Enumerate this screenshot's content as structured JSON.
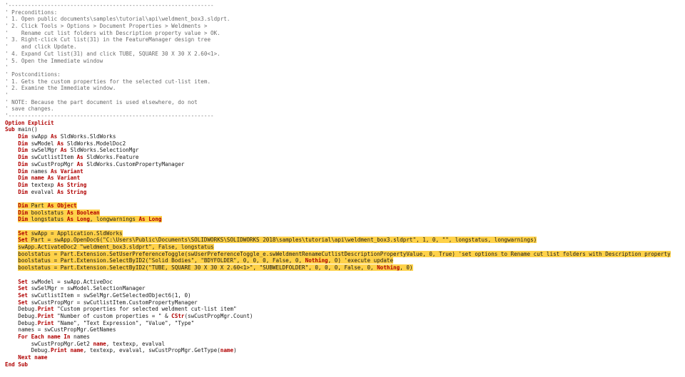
{
  "colors": {
    "keyword": "#b00000",
    "comment": "#6b6b6b",
    "text": "#1a1a1a",
    "highlight": "#ffd24a",
    "background": "#ffffff"
  },
  "lines": [
    {
      "hl": false,
      "parts": [
        {
          "t": "'---------------------------------------------------------------",
          "c": "c"
        }
      ]
    },
    {
      "hl": false,
      "parts": [
        {
          "t": "' Preconditions:",
          "c": "c"
        }
      ]
    },
    {
      "hl": false,
      "parts": [
        {
          "t": "' 1. Open public documents\\samples\\tutorial\\api\\weldment_box3.sldprt.",
          "c": "c"
        }
      ]
    },
    {
      "hl": false,
      "parts": [
        {
          "t": "' 2. Click Tools > Options > Document Properties > Weldments >",
          "c": "c"
        }
      ]
    },
    {
      "hl": false,
      "parts": [
        {
          "t": "'    Rename cut list folders with Description property value > OK.",
          "c": "c"
        }
      ]
    },
    {
      "hl": false,
      "parts": [
        {
          "t": "' 3. Right-click Cut list(31) in the FeatureManager design tree",
          "c": "c"
        }
      ]
    },
    {
      "hl": false,
      "parts": [
        {
          "t": "'    and click Update.",
          "c": "c"
        }
      ]
    },
    {
      "hl": false,
      "parts": [
        {
          "t": "' 4. Expand Cut list(31) and click TUBE, SQUARE 30 X 30 X 2.60<1>.",
          "c": "c"
        }
      ]
    },
    {
      "hl": false,
      "parts": [
        {
          "t": "' 5. Open the Immediate window",
          "c": "c"
        }
      ]
    },
    {
      "hl": false,
      "parts": [
        {
          "t": "'",
          "c": "c"
        }
      ]
    },
    {
      "hl": false,
      "parts": [
        {
          "t": "' Postconditions:",
          "c": "c"
        }
      ]
    },
    {
      "hl": false,
      "parts": [
        {
          "t": "' 1. Gets the custom properties for the selected cut-list item.",
          "c": "c"
        }
      ]
    },
    {
      "hl": false,
      "parts": [
        {
          "t": "' 2. Examine the Immediate window.",
          "c": "c"
        }
      ]
    },
    {
      "hl": false,
      "parts": [
        {
          "t": "'",
          "c": "c"
        }
      ]
    },
    {
      "hl": false,
      "parts": [
        {
          "t": "' NOTE: Because the part document is used elsewhere, do not",
          "c": "c"
        }
      ]
    },
    {
      "hl": false,
      "parts": [
        {
          "t": "' save changes.",
          "c": "c"
        }
      ]
    },
    {
      "hl": false,
      "parts": [
        {
          "t": "'---------------------------------------------------------------",
          "c": "c"
        }
      ]
    },
    {
      "hl": false,
      "parts": [
        {
          "t": "Option Explicit",
          "c": "k"
        }
      ]
    },
    {
      "hl": false,
      "parts": [
        {
          "t": "Sub ",
          "c": "k"
        },
        {
          "t": "main()",
          "c": "t"
        }
      ]
    },
    {
      "hl": false,
      "parts": [
        {
          "t": "    Dim ",
          "c": "k"
        },
        {
          "t": "swApp ",
          "c": "t"
        },
        {
          "t": "As ",
          "c": "k"
        },
        {
          "t": "SldWorks.SldWorks",
          "c": "t"
        }
      ]
    },
    {
      "hl": false,
      "parts": [
        {
          "t": "    Dim ",
          "c": "k"
        },
        {
          "t": "swModel ",
          "c": "t"
        },
        {
          "t": "As ",
          "c": "k"
        },
        {
          "t": "SldWorks.ModelDoc2",
          "c": "t"
        }
      ]
    },
    {
      "hl": false,
      "parts": [
        {
          "t": "    Dim ",
          "c": "k"
        },
        {
          "t": "swSelMgr ",
          "c": "t"
        },
        {
          "t": "As ",
          "c": "k"
        },
        {
          "t": "SldWorks.SelectionMgr",
          "c": "t"
        }
      ]
    },
    {
      "hl": false,
      "parts": [
        {
          "t": "    Dim ",
          "c": "k"
        },
        {
          "t": "swCutlistItem ",
          "c": "t"
        },
        {
          "t": "As ",
          "c": "k"
        },
        {
          "t": "SldWorks.Feature",
          "c": "t"
        }
      ]
    },
    {
      "hl": false,
      "parts": [
        {
          "t": "    Dim ",
          "c": "k"
        },
        {
          "t": "swCustPropMgr ",
          "c": "t"
        },
        {
          "t": "As ",
          "c": "k"
        },
        {
          "t": "SldWorks.CustomPropertyManager",
          "c": "t"
        }
      ]
    },
    {
      "hl": false,
      "parts": [
        {
          "t": "    Dim ",
          "c": "k"
        },
        {
          "t": "names ",
          "c": "t"
        },
        {
          "t": "As Variant",
          "c": "k"
        }
      ]
    },
    {
      "hl": false,
      "parts": [
        {
          "t": "    Dim ",
          "c": "k"
        },
        {
          "t": "name ",
          "c": "k"
        },
        {
          "t": "As Variant",
          "c": "k"
        }
      ]
    },
    {
      "hl": false,
      "parts": [
        {
          "t": "    Dim ",
          "c": "k"
        },
        {
          "t": "textexp ",
          "c": "t"
        },
        {
          "t": "As String",
          "c": "k"
        }
      ]
    },
    {
      "hl": false,
      "parts": [
        {
          "t": "    Dim ",
          "c": "k"
        },
        {
          "t": "evalval ",
          "c": "t"
        },
        {
          "t": "As String",
          "c": "k"
        }
      ]
    },
    {
      "hl": false,
      "parts": [
        {
          "t": "",
          "c": "t"
        }
      ]
    },
    {
      "hl": true,
      "parts": [
        {
          "t": "    "
        },
        {
          "t": "Dim ",
          "c": "k",
          "h": 1
        },
        {
          "t": "Part ",
          "c": "t",
          "h": 1
        },
        {
          "t": "As Object",
          "c": "k",
          "h": 1
        }
      ]
    },
    {
      "hl": true,
      "parts": [
        {
          "t": "    "
        },
        {
          "t": "Dim ",
          "c": "k",
          "h": 1
        },
        {
          "t": "boolstatus ",
          "c": "t",
          "h": 1
        },
        {
          "t": "As Boolean",
          "c": "k",
          "h": 1
        }
      ]
    },
    {
      "hl": true,
      "parts": [
        {
          "t": "    "
        },
        {
          "t": "Dim ",
          "c": "k",
          "h": 1
        },
        {
          "t": "longstatus ",
          "c": "t",
          "h": 1
        },
        {
          "t": "As Long",
          "c": "k",
          "h": 1
        },
        {
          "t": ", longwarnings ",
          "c": "t",
          "h": 1
        },
        {
          "t": "As Long",
          "c": "k",
          "h": 1
        }
      ]
    },
    {
      "hl": false,
      "parts": [
        {
          "t": "",
          "c": "t"
        }
      ]
    },
    {
      "hl": true,
      "parts": [
        {
          "t": "    "
        },
        {
          "t": "Set ",
          "c": "k",
          "h": 1
        },
        {
          "t": "swApp = Application.SldWorks",
          "c": "t",
          "h": 1
        }
      ]
    },
    {
      "hl": true,
      "parts": [
        {
          "t": "    "
        },
        {
          "t": "Set ",
          "c": "k",
          "h": 1
        },
        {
          "t": "Part = swApp.OpenDoc6(\"C:\\Users\\Public\\Documents\\SOLIDWORKS\\SOLIDWORKS 2018\\samples\\tutorial\\api\\weldment_box3.sldprt\", 1, 0, \"\", longstatus, longwarnings)",
          "c": "t",
          "h": 1
        }
      ]
    },
    {
      "hl": true,
      "parts": [
        {
          "t": "    "
        },
        {
          "t": "swApp.ActivateDoc2 \"weldment_box3.sldprt\", False, longstatus",
          "c": "t",
          "h": 1
        }
      ]
    },
    {
      "hl": true,
      "parts": [
        {
          "t": "    "
        },
        {
          "t": "boolstatus = Part.Extension.SetUserPreferenceToggle(swUserPreferenceToggle_e.swWeldmentRenameCutlistDescriptionPropertyValue, 0, True) 'set options to Rename cut list folders with Description property",
          "c": "t",
          "h": 1
        }
      ]
    },
    {
      "hl": true,
      "parts": [
        {
          "t": "    "
        },
        {
          "t": "boolstatus = Part.Extension.SelectByID2(\"Solid Bodies\", \"BDYFOLDER\", 0, 0, 0, False, 0, ",
          "c": "t",
          "h": 1
        },
        {
          "t": "Nothing",
          "c": "k",
          "h": 1
        },
        {
          "t": ", 0) 'execute update",
          "c": "t",
          "h": 1
        }
      ]
    },
    {
      "hl": true,
      "parts": [
        {
          "t": "    "
        },
        {
          "t": "boolstatus = Part.Extension.SelectByID2(\"TUBE, SQUARE 30 X 30 X 2.60<1>\", \"SUBWELDFOLDER\", 0, 0, 0, False, 0, ",
          "c": "t",
          "h": 1
        },
        {
          "t": "Nothing",
          "c": "k",
          "h": 1
        },
        {
          "t": ", 0)",
          "c": "t",
          "h": 1
        }
      ]
    },
    {
      "hl": false,
      "parts": [
        {
          "t": "",
          "c": "t"
        }
      ]
    },
    {
      "hl": false,
      "parts": [
        {
          "t": "    Set ",
          "c": "k"
        },
        {
          "t": "swModel = swApp.ActiveDoc",
          "c": "t"
        }
      ]
    },
    {
      "hl": false,
      "parts": [
        {
          "t": "    Set ",
          "c": "k"
        },
        {
          "t": "swSelMgr = swModel.SelectionManager",
          "c": "t"
        }
      ]
    },
    {
      "hl": false,
      "parts": [
        {
          "t": "    Set ",
          "c": "k"
        },
        {
          "t": "swCutlistItem = swSelMgr.GetSelectedObject6(1, 0)",
          "c": "t"
        }
      ]
    },
    {
      "hl": false,
      "parts": [
        {
          "t": "    Set ",
          "c": "k"
        },
        {
          "t": "swCustPropMgr = swCutlistItem.CustomPropertyManager",
          "c": "t"
        }
      ]
    },
    {
      "hl": false,
      "parts": [
        {
          "t": "    Debug.",
          "c": "t"
        },
        {
          "t": "Print ",
          "c": "k"
        },
        {
          "t": "\"Custom properties for selected weldment cut-list item\"",
          "c": "t"
        }
      ]
    },
    {
      "hl": false,
      "parts": [
        {
          "t": "    Debug.",
          "c": "t"
        },
        {
          "t": "Print ",
          "c": "k"
        },
        {
          "t": "\"Number of custom properties = \" & ",
          "c": "t"
        },
        {
          "t": "CStr",
          "c": "k"
        },
        {
          "t": "(swCustPropMgr.Count)",
          "c": "t"
        }
      ]
    },
    {
      "hl": false,
      "parts": [
        {
          "t": "    Debug.",
          "c": "t"
        },
        {
          "t": "Print ",
          "c": "k"
        },
        {
          "t": "\"Name\", \"Text Expression\", \"Value\", \"Type\"",
          "c": "t"
        }
      ]
    },
    {
      "hl": false,
      "parts": [
        {
          "t": "    names = swCustPropMgr.GetNames",
          "c": "t"
        }
      ]
    },
    {
      "hl": false,
      "parts": [
        {
          "t": "    For Each ",
          "c": "k"
        },
        {
          "t": "name ",
          "c": "k"
        },
        {
          "t": "In ",
          "c": "k"
        },
        {
          "t": "names",
          "c": "t"
        }
      ]
    },
    {
      "hl": false,
      "parts": [
        {
          "t": "        swCustPropMgr.Get2 ",
          "c": "t"
        },
        {
          "t": "name",
          "c": "k"
        },
        {
          "t": ", textexp, evalval",
          "c": "t"
        }
      ]
    },
    {
      "hl": false,
      "parts": [
        {
          "t": "        Debug.",
          "c": "t"
        },
        {
          "t": "Print ",
          "c": "k"
        },
        {
          "t": "name",
          "c": "k"
        },
        {
          "t": ", textexp, evalval, swCustPropMgr.GetType(",
          "c": "t"
        },
        {
          "t": "name",
          "c": "k"
        },
        {
          "t": ")",
          "c": "t"
        }
      ]
    },
    {
      "hl": false,
      "parts": [
        {
          "t": "    Next ",
          "c": "k"
        },
        {
          "t": "name",
          "c": "k"
        }
      ]
    },
    {
      "hl": false,
      "parts": [
        {
          "t": "End Sub",
          "c": "k"
        }
      ]
    }
  ]
}
